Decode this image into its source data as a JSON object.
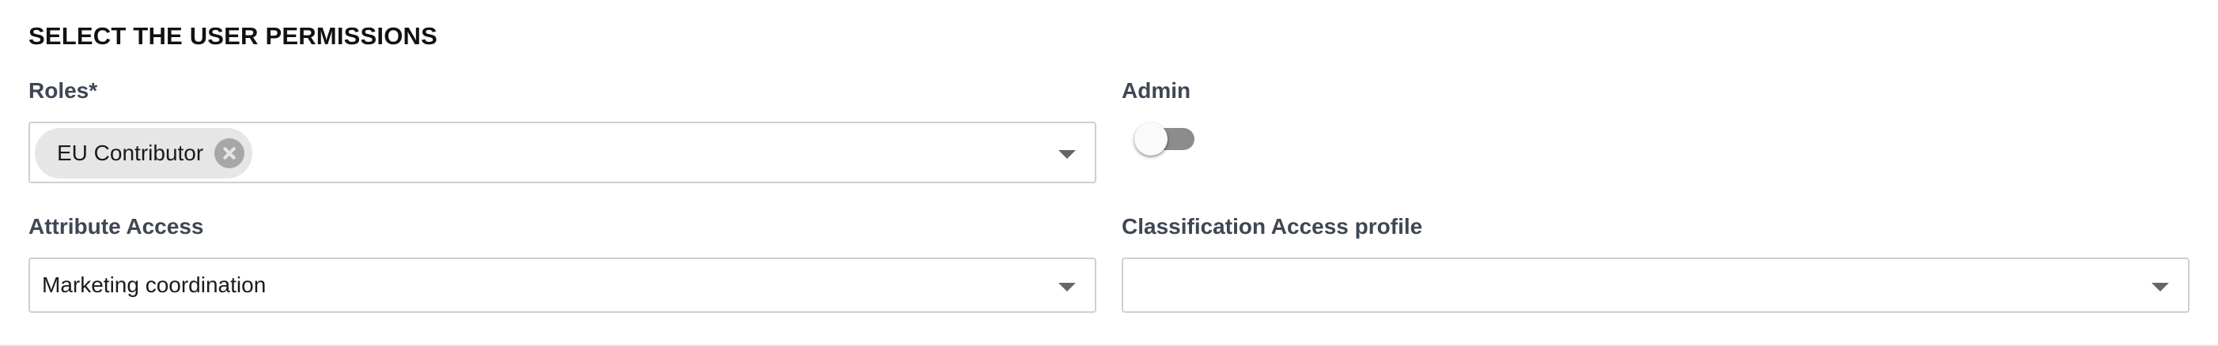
{
  "section": {
    "title": "SELECT THE USER PERMISSIONS"
  },
  "roles": {
    "label": "Roles*",
    "selected": [
      {
        "label": "EU Contributor"
      }
    ]
  },
  "admin": {
    "label": "Admin",
    "enabled": false
  },
  "attribute_access": {
    "label": "Attribute Access",
    "value": "Marketing coordination"
  },
  "classification_access": {
    "label": "Classification Access profile",
    "value": ""
  },
  "icons": {
    "chip_remove": "close-circle-icon",
    "dropdown": "chevron-down-icon"
  },
  "colors": {
    "chip_background": "#e6e6e6",
    "toggle_off_track": "#8c8c8c",
    "border": "#cfcfcf"
  }
}
